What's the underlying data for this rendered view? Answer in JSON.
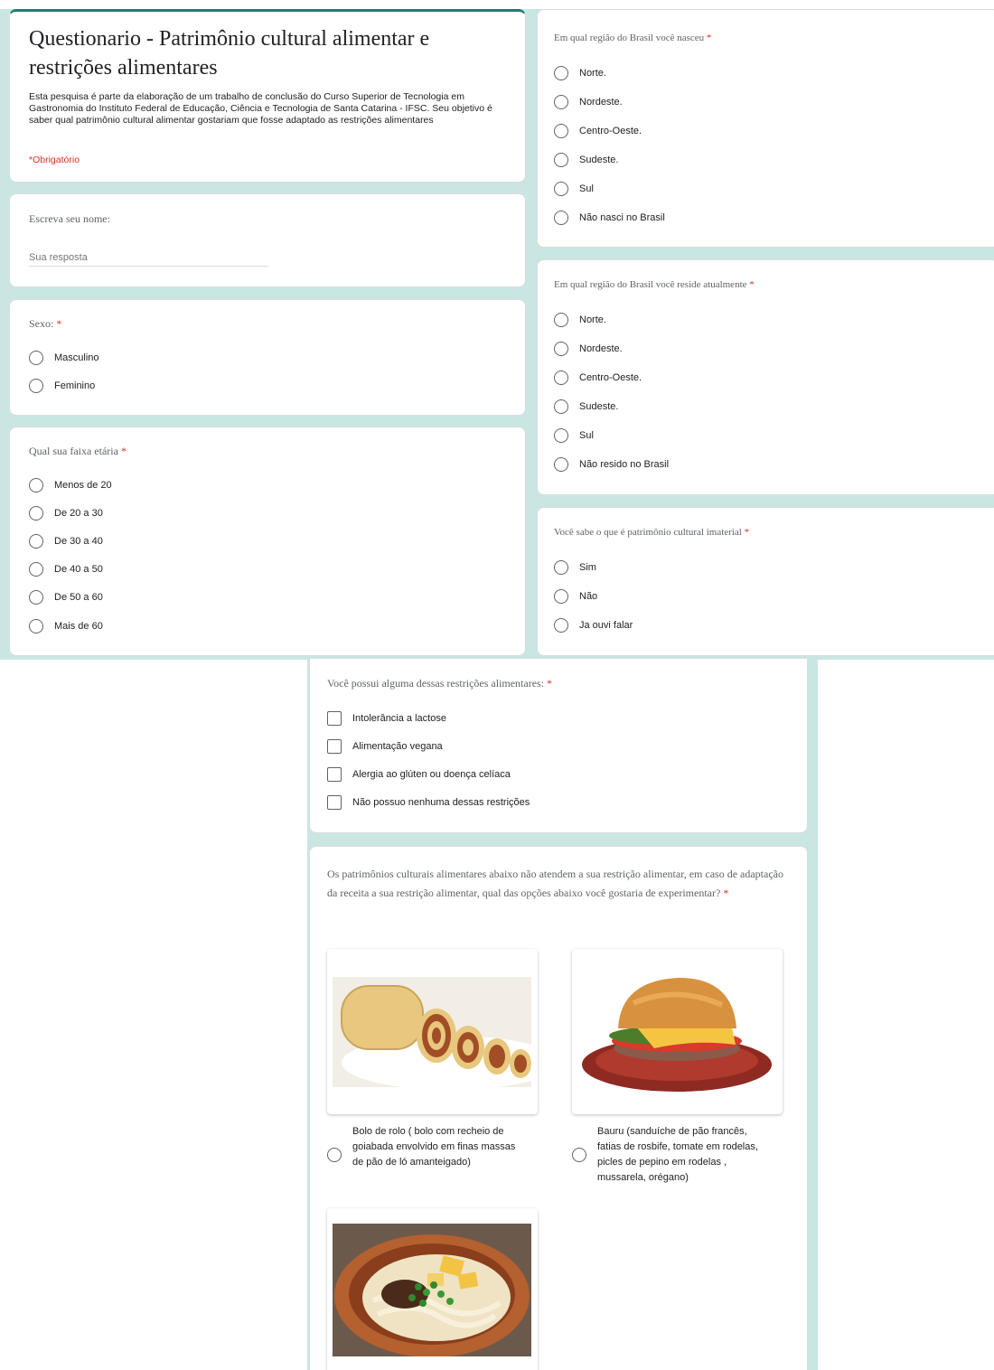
{
  "header": {
    "title": "Questionario - Patrimônio cultural alimentar e restrições alimentares",
    "description": "Esta pesquisa é parte da elaboração de um trabalho de conclusão do Curso Superior de Tecnologia em Gastronomia do Instituto Federal de Educação, Ciência e Tecnologia de Santa Catarina - IFSC. Seu objetivo é saber qual patrimônio cultural alimentar gostariam que fosse adaptado as restrições alimentares",
    "required_note": "*Obrigatório"
  },
  "name_question": {
    "title": "Escreva seu nome:",
    "placeholder": "Sua resposta"
  },
  "sex_question": {
    "title": "Sexo:",
    "required_mark": "*",
    "options": [
      "Masculino",
      "Feminino"
    ]
  },
  "age_question": {
    "title": "Qual sua faixa etária",
    "required_mark": "*",
    "options": [
      "Menos de 20",
      "De 20 a 30",
      "De 30 a 40",
      "De 40 a 50",
      "De 50 a 60",
      "Mais de 60"
    ]
  },
  "birth_region_question": {
    "title": "Em qual região do Brasil você nasceu",
    "required_mark": "*",
    "options": [
      "Norte.",
      "Nordeste.",
      "Centro-Oeste.",
      "Sudeste.",
      "Sul",
      "Não nasci no Brasil"
    ]
  },
  "residence_region_question": {
    "title": "Em qual região do Brasil você reside atualmente",
    "required_mark": "*",
    "options": [
      "Norte.",
      "Nordeste.",
      "Centro-Oeste.",
      "Sudeste.",
      "Sul",
      "Não resido no Brasil"
    ]
  },
  "heritage_question": {
    "title": "Você sabe o que é patrimônio cultural imaterial",
    "required_mark": "*",
    "options": [
      "Sim",
      "Não",
      "Ja ouvi falar"
    ]
  },
  "restriction_question": {
    "title": "Você possui alguma dessas restrições alimentares:",
    "required_mark": "*",
    "options": [
      "Intolerância a lactose",
      "Alimentação vegana",
      "Alergia ao glúten ou doença celíaca",
      "Não possuo nenhuma dessas restrições"
    ]
  },
  "dish_question": {
    "title": "Os patrimônios culturais alimentares abaixo não atendem a sua restrição alimentar, em caso de adaptação da receita a sua restrição alimentar, qual das opções abaixo você gostaria de experimentar?",
    "required_mark": "*",
    "options": [
      {
        "label": "Bolo de rolo ( bolo com recheio de goiabada envolvido em finas massas de pão de ló amanteigado)",
        "icon": "bolo-de-rolo-image"
      },
      {
        "label": "Bauru (sanduíche de pão francês, fatias de rosbife, tomate em rodelas, picles de pepino em rodelas , mussarela, orégano)",
        "icon": "bauru-sandwich-image"
      },
      {
        "label": "",
        "icon": "noodle-bowl-image"
      }
    ]
  },
  "colors": {
    "accent": "#1a7f74",
    "background_band": "#c9e6e3",
    "required": "#d93025"
  }
}
